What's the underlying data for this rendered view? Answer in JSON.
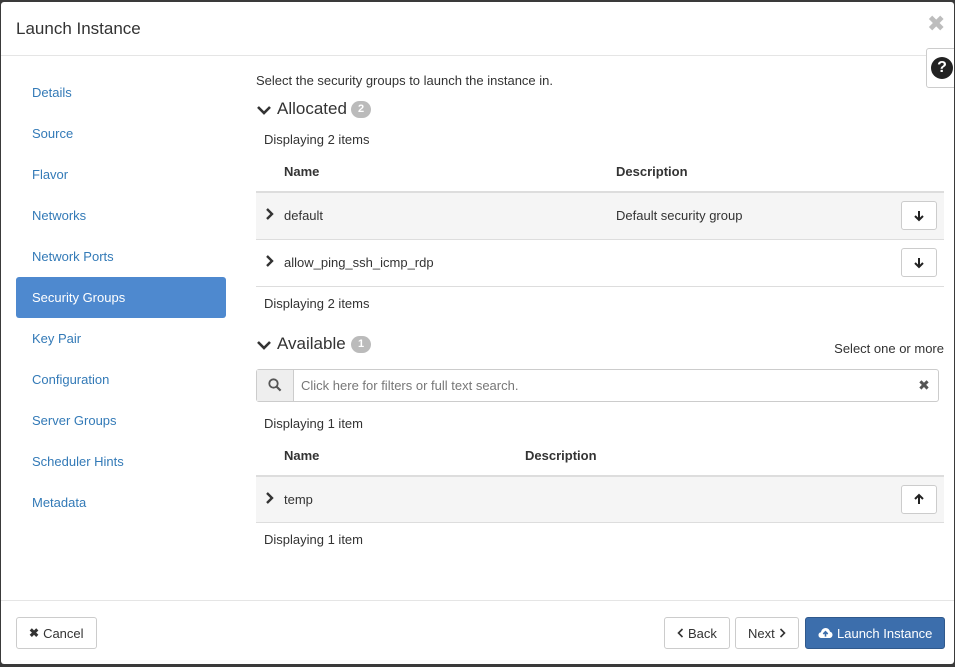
{
  "modal": {
    "title": "Launch Instance",
    "close_glyph": "✖",
    "help_glyph": "?"
  },
  "sidebar": {
    "items": [
      {
        "label": "Details"
      },
      {
        "label": "Source"
      },
      {
        "label": "Flavor"
      },
      {
        "label": "Networks"
      },
      {
        "label": "Network Ports"
      },
      {
        "label": "Security Groups",
        "active": true
      },
      {
        "label": "Key Pair"
      },
      {
        "label": "Configuration"
      },
      {
        "label": "Server Groups"
      },
      {
        "label": "Scheduler Hints"
      },
      {
        "label": "Metadata"
      }
    ]
  },
  "content": {
    "intro": "Select the security groups to launch the instance in.",
    "allocated": {
      "title": "Allocated",
      "count": "2",
      "displaying": "Displaying 2 items",
      "columns": {
        "name": "Name",
        "description": "Description"
      },
      "rows": [
        {
          "name": "default",
          "description": "Default security group"
        },
        {
          "name": "allow_ping_ssh_icmp_rdp",
          "description": ""
        }
      ],
      "displaying_footer": "Displaying 2 items"
    },
    "available": {
      "title": "Available",
      "count": "1",
      "select_hint": "Select one or more",
      "search_placeholder": "Click here for filters or full text search.",
      "displaying": "Displaying 1 item",
      "columns": {
        "name": "Name",
        "description": "Description"
      },
      "rows": [
        {
          "name": "temp",
          "description": ""
        }
      ],
      "displaying_footer": "Displaying 1 item"
    }
  },
  "footer": {
    "cancel": "Cancel",
    "back": "Back",
    "next": "Next",
    "launch": "Launch Instance"
  },
  "colors": {
    "accent": "#4e89cf",
    "primary_button": "#3c6eac",
    "link": "#337ab7"
  }
}
